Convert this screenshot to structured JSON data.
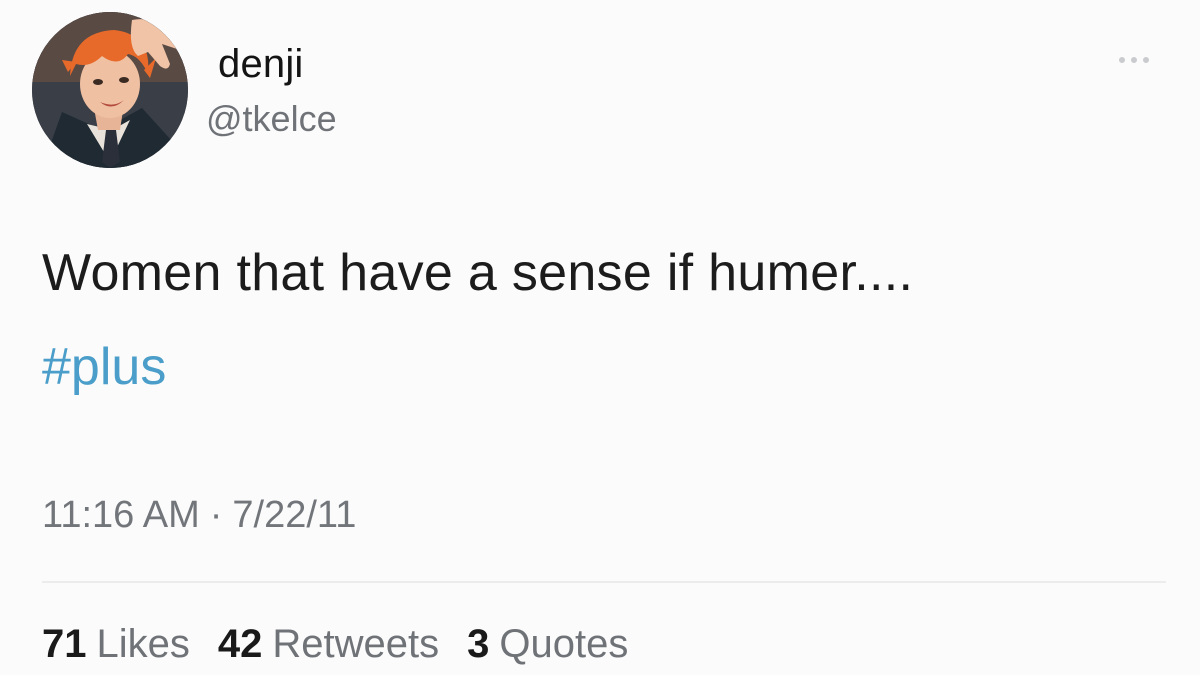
{
  "user": {
    "display_name": "denji",
    "handle": "@tkelce"
  },
  "tweet": {
    "text": "Women that have a sense if humer....",
    "hashtag": "#plus",
    "time": "11:16 AM",
    "separator": "·",
    "date": "7/22/11"
  },
  "stats": {
    "likes_count": "71",
    "likes_label": "Likes",
    "retweets_count": "42",
    "retweets_label": "Retweets",
    "quotes_count": "3",
    "quotes_label": "Quotes"
  },
  "colors": {
    "hashtag": "#4a9ec9",
    "secondary_text": "#6f7378",
    "background": "#fbfbfb"
  },
  "icons": {
    "more": "more-horizontal-icon"
  }
}
